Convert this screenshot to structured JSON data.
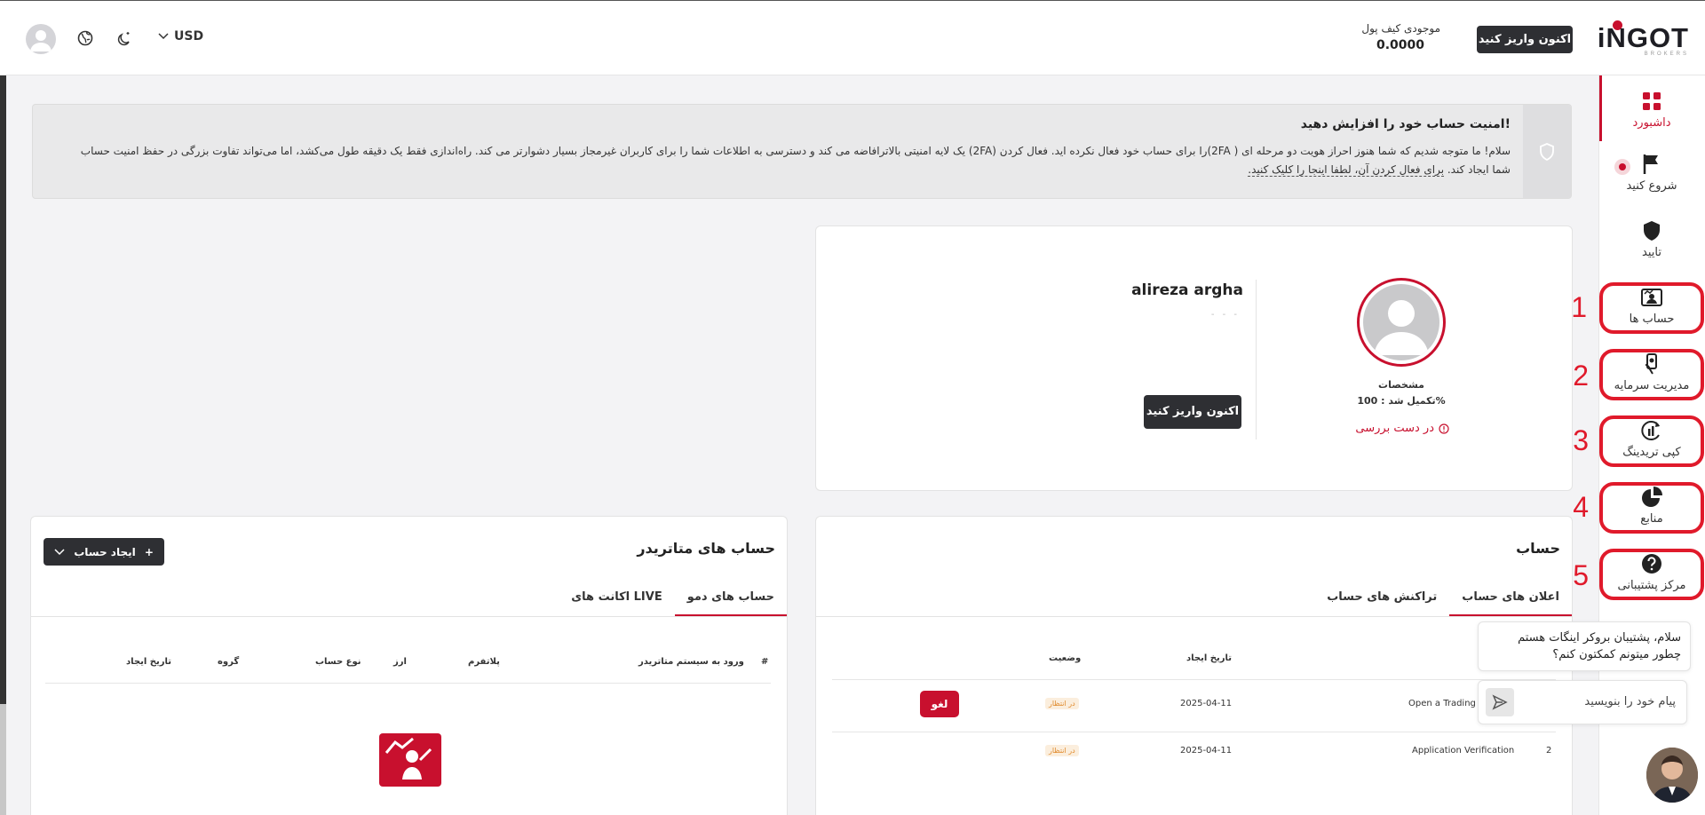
{
  "header": {
    "logo_text": "iNGOT",
    "logo_sub": "BROKERS",
    "deposit_label": "اکنون واریز کنید",
    "wallet_title": "موجودی کیف پول",
    "wallet_value": "0.0000",
    "currency": "USD"
  },
  "sidebar": {
    "items": [
      {
        "label": "داشبورد",
        "icon": "dashboard-icon"
      },
      {
        "label": "شروع کنید",
        "icon": "flag-icon"
      },
      {
        "label": "تایید",
        "icon": "shield-icon"
      },
      {
        "label": "حساب ها",
        "icon": "accounts-icon"
      },
      {
        "label": "مدیریت سرمایه",
        "icon": "money-hand-icon"
      },
      {
        "label": "کپی تریدینگ",
        "icon": "copy-trading-icon"
      },
      {
        "label": "منابع",
        "icon": "pie-chart-icon"
      },
      {
        "label": "مرکز پشتیبانی",
        "icon": "help-icon"
      }
    ],
    "annotations": [
      "1",
      "2",
      "3",
      "4",
      "5"
    ]
  },
  "alert": {
    "title": "امنیت حساب خود را افزایش دهید!",
    "body": "سلام! ما متوجه شدیم که شما هنوز احراز هویت دو مرحله ای ( 2FA)را برای حساب خود فعال نکرده اید. فعال کردن (2FA) یک لایه امنیتی بالاترافاضه می کند و دسترسی به اطلاعات شما را برای کاربران غیرمجاز بسیار دشوارتر می کند. راه‌اندازی فقط یک دقیقه طول می‌کشد، اما می‌تواند تفاوت بزرگی در حفظ امنیت حساب شما ایجاد کند. ",
    "link": "برای فعال کردن آن، لطفا اینجا را کلیک کنید."
  },
  "profile": {
    "details_label": "مشخصات",
    "complete_label": "تکمیل شد : 100%",
    "status": "در دست بررسی",
    "name": "alireza argha",
    "sub": "- - -",
    "deposit_label": "اکنون واریز کنید"
  },
  "account": {
    "title": "حساب",
    "tabs": [
      "اعلان های حساب",
      "تراکنش های حساب"
    ],
    "headers": {
      "status": "وضعیت",
      "created": "تاریخ ایجاد"
    },
    "rows": [
      {
        "index": "",
        "name": "Open a Trading",
        "date": "2025-04-11",
        "status": "در انتظار",
        "action": "لغو"
      },
      {
        "index": "2",
        "name": "Application Verification",
        "date": "2025-04-11",
        "status": "در انتظار",
        "action": ""
      }
    ]
  },
  "metatrader": {
    "title": "حساب های متاتریدر",
    "create_label": "ایجاد حساب",
    "tabs": [
      "حساب های دمو",
      "اکانت های LIVE"
    ],
    "headers": {
      "index": "#",
      "login": "ورود به سیستم متاتریدر",
      "platform": "پلاتفرم",
      "currency": "ارز",
      "type": "نوع حساب",
      "group": "گروه",
      "created": "تاریخ ایجاد"
    }
  },
  "chat": {
    "message": "سلام، پشتیبان بروکر اینگات هستم چطور میتونم کمکتون کنم؟",
    "placeholder": "پیام خود را بنویسید"
  },
  "colors": {
    "accent": "#c8102e",
    "dark": "#2e2f33",
    "annotation": "#e01a2b"
  }
}
